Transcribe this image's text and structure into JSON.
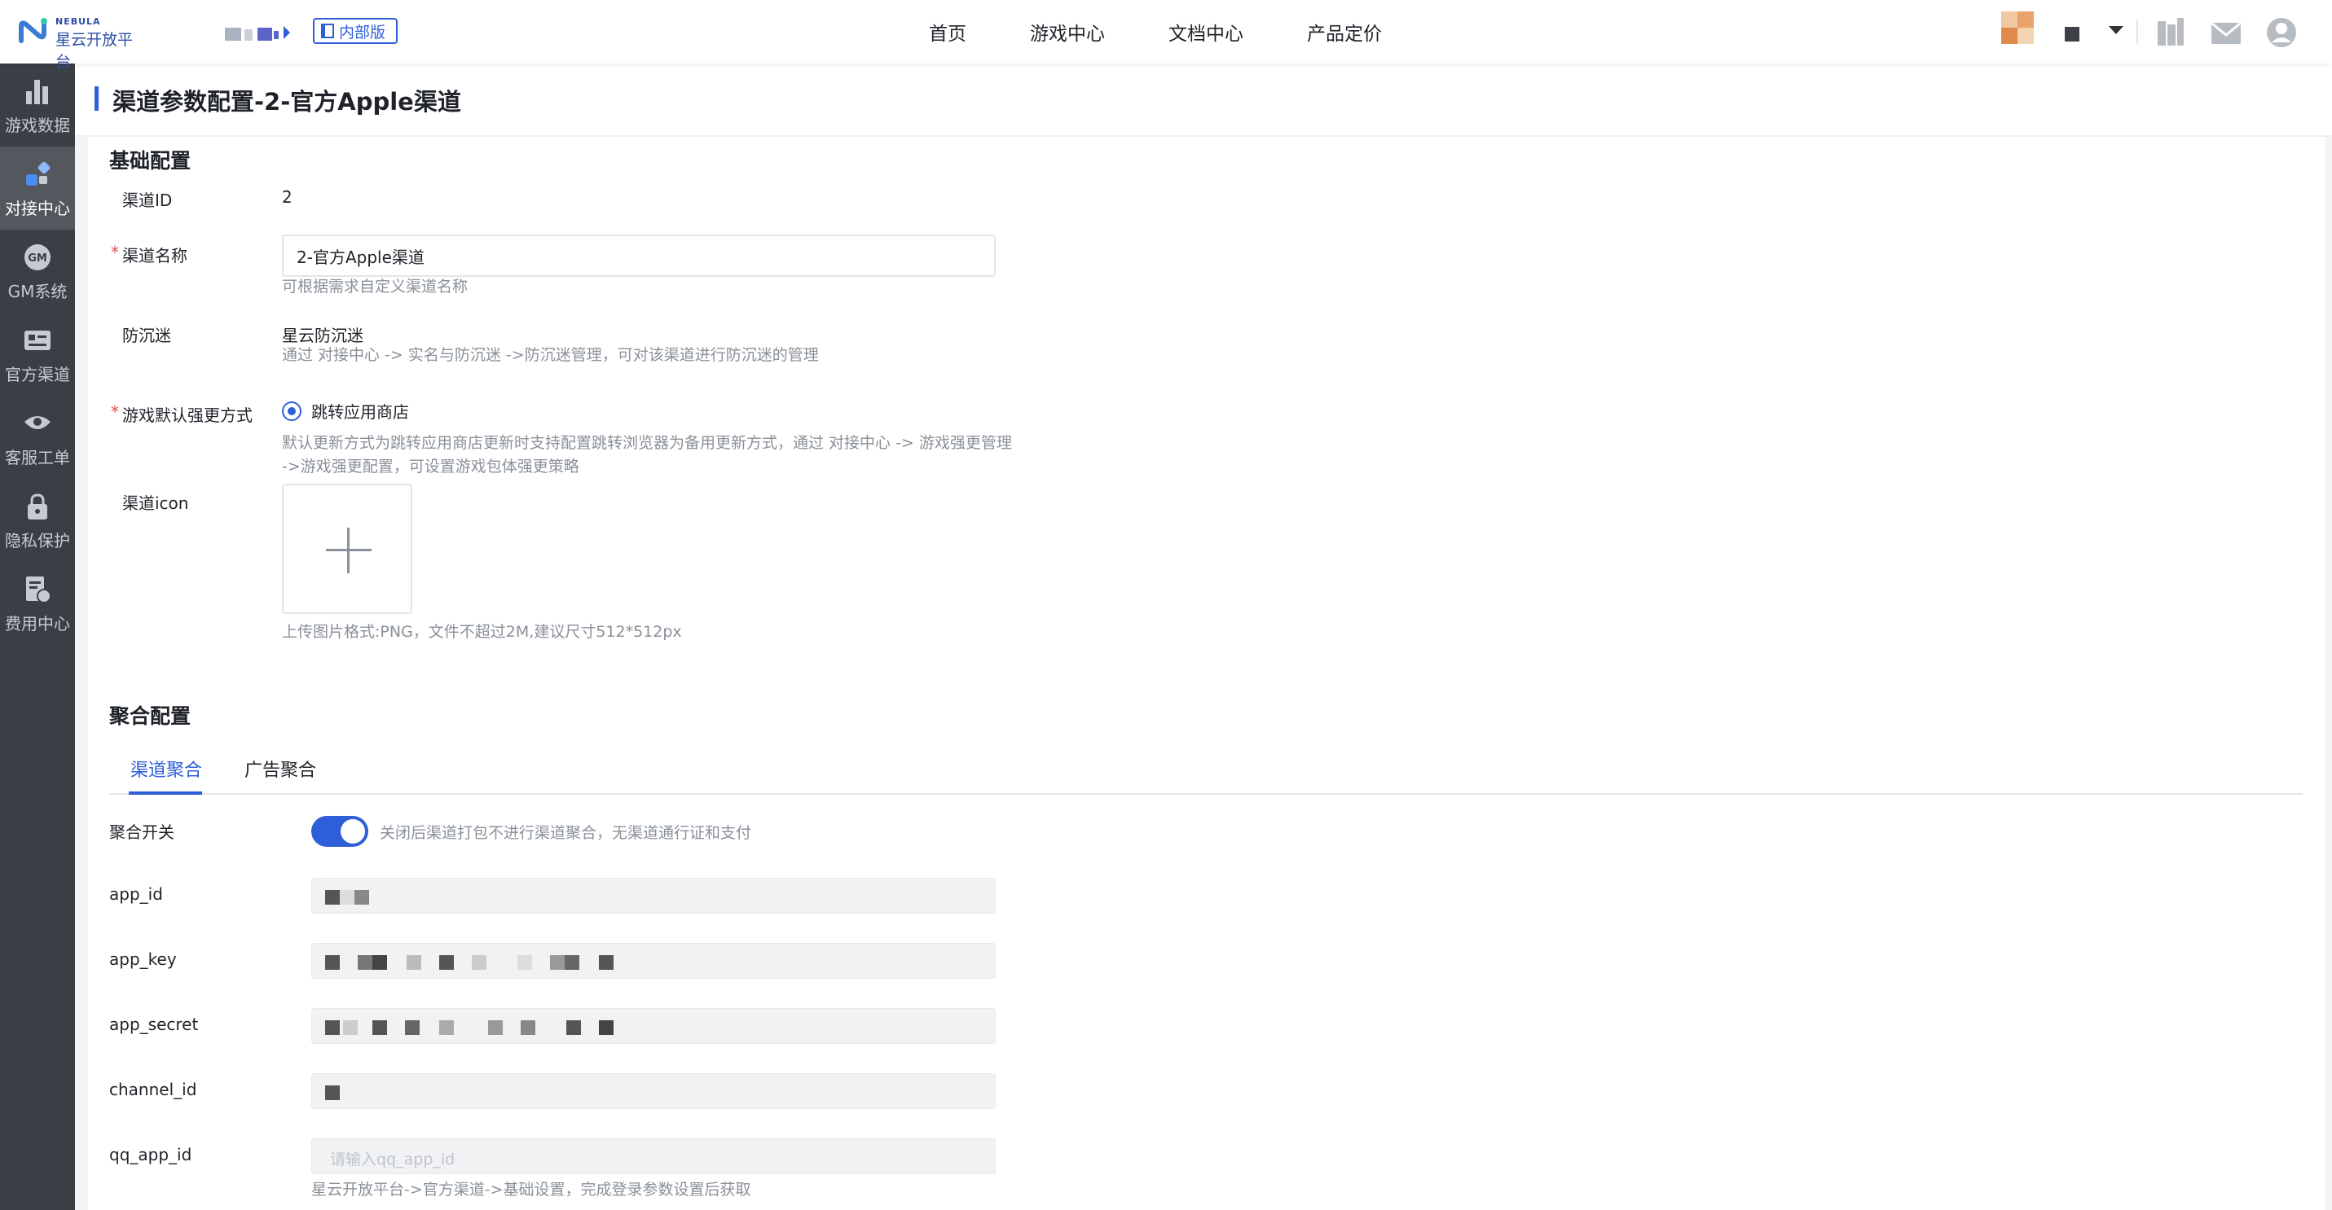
{
  "header": {
    "logo": {
      "en": "NEBULA",
      "cn": "星云开放平台"
    },
    "badge": "内部版",
    "nav": [
      "首页",
      "游戏中心",
      "文档中心",
      "产品定价"
    ]
  },
  "sidebar": {
    "items": [
      {
        "label": "游戏数据",
        "icon": "bar-chart-icon"
      },
      {
        "label": "对接中心",
        "icon": "integration-icon",
        "active": true
      },
      {
        "label": "GM系统",
        "icon": "gm-icon"
      },
      {
        "label": "官方渠道",
        "icon": "id-card-icon"
      },
      {
        "label": "客服工单",
        "icon": "eye-icon"
      },
      {
        "label": "隐私保护",
        "icon": "lock-icon"
      },
      {
        "label": "费用中心",
        "icon": "bill-icon"
      }
    ]
  },
  "page": {
    "title": "渠道参数配置-2-官方Apple渠道"
  },
  "basic": {
    "section_title": "基础配置",
    "channel_id": {
      "label": "渠道ID",
      "value": "2"
    },
    "channel_name": {
      "label": "渠道名称",
      "value": "2-官方Apple渠道",
      "hint": "可根据需求自定义渠道名称"
    },
    "anti_addiction": {
      "label": "防沉迷",
      "value": "星云防沉迷",
      "hint": "通过 对接中心 -> 实名与防沉迷 ->防沉迷管理，可对该渠道进行防沉迷的管理"
    },
    "update_mode": {
      "label": "游戏默认强更方式",
      "option": "跳转应用商店",
      "hint_line1": "默认更新方式为跳转应用商店更新时支持配置跳转浏览器为备用更新方式，通过 对接中心 -> 游戏强更管理",
      "hint_line2": "->游戏强更配置，可设置游戏包体强更策略"
    },
    "icon": {
      "label": "渠道icon",
      "hint": "上传图片格式:PNG，文件不超过2M,建议尺寸512*512px"
    }
  },
  "aggregation": {
    "section_title": "聚合配置",
    "tabs": [
      "渠道聚合",
      "广告聚合"
    ],
    "switch": {
      "label": "聚合开关",
      "on": true,
      "hint": "关闭后渠道打包不进行渠道聚合，无渠道通行证和支付"
    },
    "fields": [
      {
        "label": "app_id"
      },
      {
        "label": "app_key"
      },
      {
        "label": "app_secret"
      },
      {
        "label": "channel_id"
      },
      {
        "label": "qq_app_id",
        "placeholder": "请输入qq_app_id"
      }
    ],
    "footer_hint": "星云开放平台->官方渠道->基础设置，完成登录参数设置后获取"
  },
  "colors": {
    "accent": "#2e5fd8",
    "sidebar_bg": "#3b3e44",
    "required": "#e34d4d"
  }
}
